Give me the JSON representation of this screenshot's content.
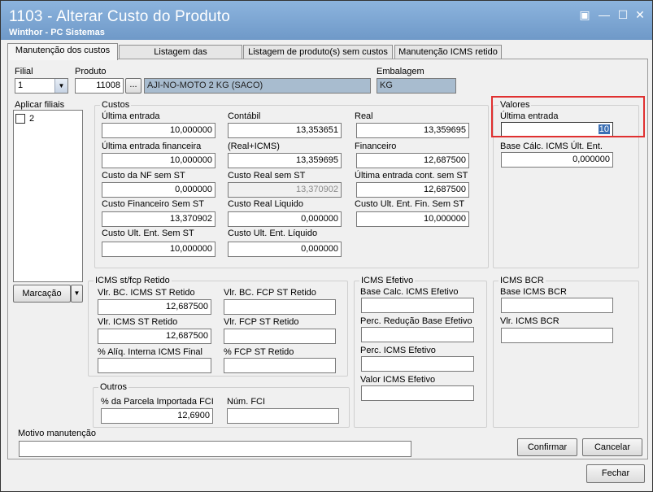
{
  "window": {
    "title": "1103 - Alterar Custo do Produto",
    "subtitle": "Winthor - PC Sistemas",
    "controls": {
      "restore": "▣",
      "minimize": "—",
      "maximize": "☐",
      "close": "✕"
    }
  },
  "tabs": [
    {
      "label": "Manutenção dos custos"
    },
    {
      "label": "Listagem das movimentações"
    },
    {
      "label": "Listagem de produto(s) sem custos"
    },
    {
      "label": "Manutenção ICMS retido"
    }
  ],
  "header": {
    "filial_label": "Filial",
    "filial_value": "1",
    "produto_label": "Produto",
    "produto_code": "11008",
    "produto_browse": "...",
    "produto_desc": "AJI-NO-MOTO 2 KG (SACO)",
    "embalagem_label": "Embalagem",
    "embalagem_value": "KG"
  },
  "aplicar_filiais": {
    "label": "Aplicar filiais",
    "items": [
      {
        "label": "2"
      }
    ],
    "marcacao_button": "Marcação"
  },
  "custos": {
    "title": "Custos",
    "fields": {
      "ultima_entrada": {
        "label": "Última entrada",
        "value": "10,000000"
      },
      "contabil": {
        "label": "Contábil",
        "value": "13,353651"
      },
      "real": {
        "label": "Real",
        "value": "13,359695"
      },
      "ultima_entrada_fin": {
        "label": "Última entrada financeira",
        "value": "10,000000"
      },
      "real_icms": {
        "label": "(Real+ICMS)",
        "value": "13,359695"
      },
      "financeiro": {
        "label": "Financeiro",
        "value": "12,687500"
      },
      "custo_nf_sem_st": {
        "label": "Custo da NF sem ST",
        "value": "0,000000"
      },
      "custo_real_sem_st": {
        "label": "Custo Real sem ST",
        "value": "13,370902"
      },
      "ultima_entrada_cont_sem_st": {
        "label": "Última entrada cont. sem ST",
        "value": "12,687500"
      },
      "custo_fin_sem_st": {
        "label": "Custo Financeiro Sem ST",
        "value": "13,370902"
      },
      "custo_real_liquido": {
        "label": "Custo Real Liquido",
        "value": "0,000000"
      },
      "custo_ult_ent_fin_sem_st": {
        "label": "Custo Ult. Ent. Fin. Sem ST",
        "value": "10,000000"
      },
      "custo_ult_ent_sem_st": {
        "label": "Custo Ult. Ent. Sem ST",
        "value": "10,000000"
      },
      "custo_ult_ent_liquido": {
        "label": "Custo Ult. Ent. Líquido",
        "value": "0,000000"
      }
    }
  },
  "valores": {
    "title": "Valores",
    "ultima_entrada_label": "Última entrada",
    "ultima_entrada_value": "10",
    "base_calc_label": "Base Cálc. ICMS Últ. Ent.",
    "base_calc_value": "0,000000"
  },
  "icms_st": {
    "title": "ICMS st/fcp Retido",
    "vlr_bc_icms_st_label": "Vlr. BC. ICMS ST Retido",
    "vlr_bc_icms_st_value": "12,687500",
    "vlr_bc_fcp_st_label": "Vlr. BC. FCP ST Retido",
    "vlr_bc_fcp_st_value": "",
    "vlr_icms_st_label": "Vlr. ICMS ST Retido",
    "vlr_icms_st_value": "12,687500",
    "vlr_fcp_st_label": "Vlr. FCP ST Retido",
    "vlr_fcp_st_value": "",
    "aliq_interna_label": "% Alíq. Interna ICMS Final",
    "aliq_interna_value": "",
    "fcp_st_retido_label": "% FCP ST Retido",
    "fcp_st_retido_value": ""
  },
  "outros": {
    "title": "Outros",
    "parcela_label": "% da Parcela Importada FCI",
    "parcela_value": "12,6900",
    "num_fci_label": "Núm. FCI",
    "num_fci_value": ""
  },
  "icms_efetivo": {
    "title": "ICMS Efetivo",
    "base_calc_label": "Base Calc. ICMS Efetivo",
    "base_calc_value": "",
    "perc_reducao_label": "Perc. Redução Base Efetivo",
    "perc_reducao_value": "",
    "perc_icms_label": "Perc. ICMS Efetivo",
    "perc_icms_value": "",
    "valor_icms_label": "Valor ICMS Efetivo",
    "valor_icms_value": ""
  },
  "icms_bcr": {
    "title": "ICMS BCR",
    "base_label": "Base ICMS BCR",
    "base_value": "",
    "vlr_label": "Vlr. ICMS BCR",
    "vlr_value": ""
  },
  "motivo": {
    "label": "Motivo manutenção",
    "value": ""
  },
  "buttons": {
    "confirmar": "Confirmar",
    "cancelar": "Cancelar",
    "fechar": "Fechar"
  }
}
